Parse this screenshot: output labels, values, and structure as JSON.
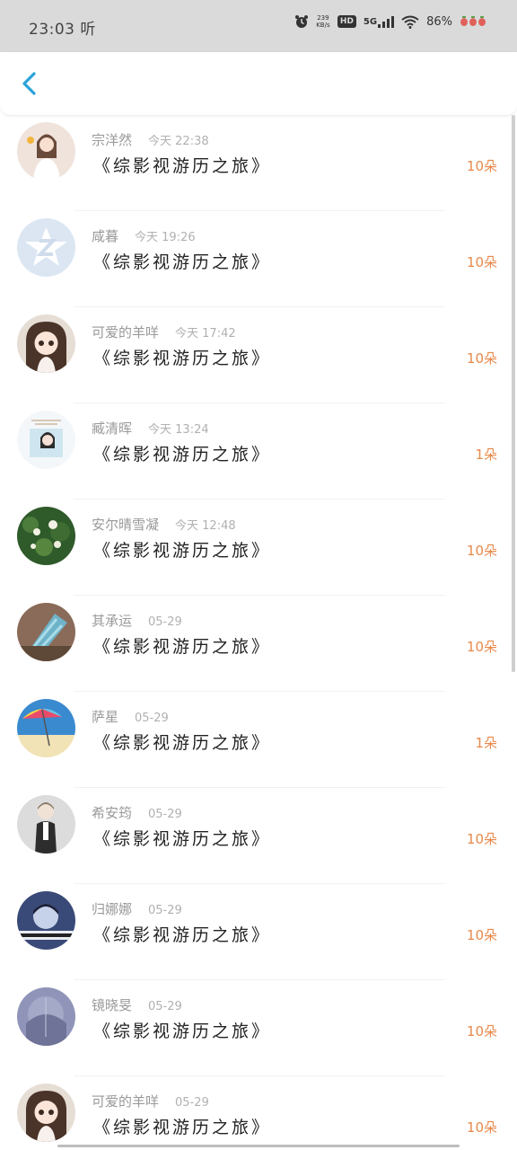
{
  "status_bar": {
    "time": "23:03 听",
    "net_speed": "239 KB/s",
    "hd": "HD",
    "network": "5G",
    "battery": "86%"
  },
  "header": {
    "back_icon": "chevron-left-icon",
    "accent": "#2aa3d9"
  },
  "records": [
    {
      "name": "宗洋然",
      "time": "今天 22:38",
      "title": "《综影视游历之旅》",
      "amount": "10朵"
    },
    {
      "name": "咸暮",
      "time": "今天 19:26",
      "title": "《综影视游历之旅》",
      "amount": "10朵"
    },
    {
      "name": "可爱的羊咩",
      "time": "今天 17:42",
      "title": "《综影视游历之旅》",
      "amount": "10朵"
    },
    {
      "name": "臧清晖",
      "time": "今天 13:24",
      "title": "《综影视游历之旅》",
      "amount": "1朵"
    },
    {
      "name": "安尔晴雪凝",
      "time": "今天 12:48",
      "title": "《综影视游历之旅》",
      "amount": "10朵"
    },
    {
      "name": "其承运",
      "time": "05-29",
      "title": "《综影视游历之旅》",
      "amount": "10朵"
    },
    {
      "name": "萨星",
      "time": "05-29",
      "title": "《综影视游历之旅》",
      "amount": "1朵"
    },
    {
      "name": "希安筠",
      "time": "05-29",
      "title": "《综影视游历之旅》",
      "amount": "10朵"
    },
    {
      "name": "归娜娜",
      "time": "05-29",
      "title": "《综影视游历之旅》",
      "amount": "10朵"
    },
    {
      "name": "镜晓旻",
      "time": "05-29",
      "title": "《综影视游历之旅》",
      "amount": "10朵"
    },
    {
      "name": "可爱的羊咩",
      "time": "05-29",
      "title": "《综影视游历之旅》",
      "amount": "10朵"
    }
  ],
  "colors": {
    "amount": "#e8894a",
    "name": "#999999",
    "title": "#222222"
  }
}
